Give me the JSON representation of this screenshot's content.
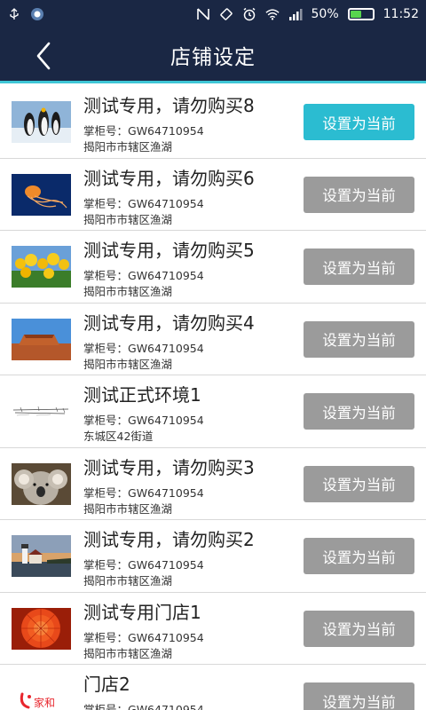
{
  "status_bar": {
    "battery_percent_text": "50%",
    "battery_level": 0.5,
    "time": "11:52"
  },
  "header": {
    "title": "店铺设定"
  },
  "stores": [
    {
      "name": "测试专用，请勿购买8",
      "cabinet_label": "掌柜号：",
      "cabinet_id": "GW64710954",
      "address": "揭阳市市辖区渔湖",
      "button_label": "设置为当前",
      "current": true
    },
    {
      "name": "测试专用，请勿购买6",
      "cabinet_label": "掌柜号：",
      "cabinet_id": "GW64710954",
      "address": "揭阳市市辖区渔湖",
      "button_label": "设置为当前",
      "current": false
    },
    {
      "name": "测试专用，请勿购买5",
      "cabinet_label": "掌柜号：",
      "cabinet_id": "GW64710954",
      "address": "揭阳市市辖区渔湖",
      "button_label": "设置为当前",
      "current": false
    },
    {
      "name": "测试专用，请勿购买4",
      "cabinet_label": "掌柜号：",
      "cabinet_id": "GW64710954",
      "address": "揭阳市市辖区渔湖",
      "button_label": "设置为当前",
      "current": false
    },
    {
      "name": "测试正式环境1",
      "cabinet_label": "掌柜号：",
      "cabinet_id": "GW64710954",
      "address": "东城区42街道",
      "button_label": "设置为当前",
      "current": false
    },
    {
      "name": "测试专用，请勿购买3",
      "cabinet_label": "掌柜号：",
      "cabinet_id": "GW64710954",
      "address": "揭阳市市辖区渔湖",
      "button_label": "设置为当前",
      "current": false
    },
    {
      "name": "测试专用，请勿购买2",
      "cabinet_label": "掌柜号：",
      "cabinet_id": "GW64710954",
      "address": "揭阳市市辖区渔湖",
      "button_label": "设置为当前",
      "current": false
    },
    {
      "name": "测试专用门店1",
      "cabinet_label": "掌柜号：",
      "cabinet_id": "GW64710954",
      "address": "揭阳市市辖区渔湖",
      "button_label": "设置为当前",
      "current": false
    },
    {
      "name": "门店2",
      "cabinet_label": "掌柜号：",
      "cabinet_id": "GW64710954",
      "address": "",
      "button_label": "设置为当前",
      "current": false,
      "logo_text": "家和"
    }
  ],
  "colors": {
    "header_bg": "#1a2744",
    "accent": "#2bbcd1",
    "button_inactive": "#9b9b9b"
  },
  "icons": [
    "usb-icon",
    "notification-icon",
    "nfc-icon",
    "rotate-icon",
    "alarm-icon",
    "wifi-icon",
    "signal-icon",
    "battery-icon",
    "back-icon"
  ]
}
